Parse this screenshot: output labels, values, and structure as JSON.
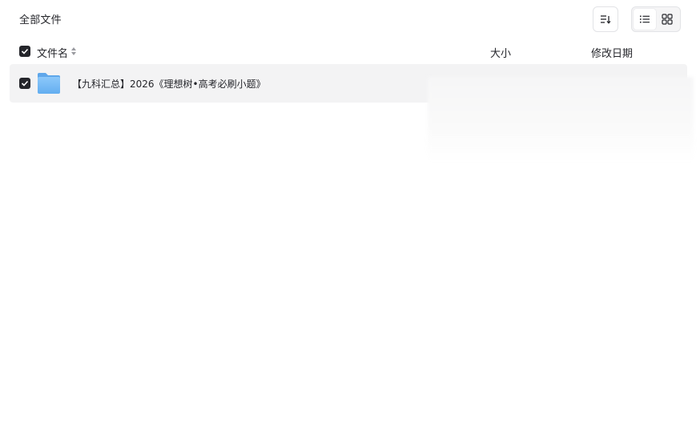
{
  "header": {
    "title": "全部文件",
    "sort_icon": "sort-icon",
    "view_modes": [
      "list-view-icon",
      "grid-view-icon"
    ],
    "active_view": "list"
  },
  "table": {
    "columns": {
      "name": "文件名",
      "size": "大小",
      "modified": "修改日期"
    },
    "select_all_checked": true,
    "rows": [
      {
        "name": "【九科汇总】2026《理想树•高考必刷小题》",
        "type": "folder",
        "checked": true,
        "size": "",
        "modified": ""
      }
    ]
  },
  "colors": {
    "row_selected_bg": "#f3f3f4",
    "folder_blue": "#7dbcf5",
    "checkbox": "#25262b"
  }
}
